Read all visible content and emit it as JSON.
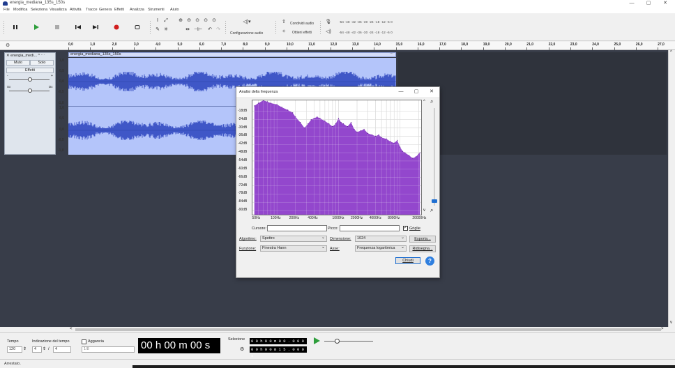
{
  "window": {
    "title": "energia_mediana_135s_150s",
    "minimize": "—",
    "maximize": "▢",
    "close": "✕"
  },
  "menu": [
    "File",
    "Modifica",
    "Seleziona",
    "Visualizza",
    "Attività",
    "Tracce",
    "Genera",
    "Effetti",
    "Analizza",
    "Strumenti",
    "Aiuto"
  ],
  "toolbar": {
    "audio_setup_label": "Configurazione audio",
    "share_audio_label": "Condividi audio",
    "get_effects_label": "Ottieni effetti",
    "meter_scale_record": "-54 -48 -42 -36 -30 -24 -18 -12 -6 0",
    "meter_scale_play": "-54 -48 -42 -36 -30 -24 -18 -12 -6 0"
  },
  "ruler": {
    "ticks": [
      "0,0",
      "1,0",
      "2,0",
      "3,0",
      "4,0",
      "5,0",
      "6,0",
      "7,0",
      "8,0",
      "9,0",
      "10,0",
      "11,0",
      "12,0",
      "13,0",
      "14,0",
      "15,0",
      "16,0",
      "17,0",
      "18,0",
      "19,0",
      "20,0",
      "21,0",
      "22,0",
      "23,0",
      "24,0",
      "25,0",
      "26,0",
      "27,0"
    ]
  },
  "track": {
    "name": "energia_medi...",
    "clip_name": "energia_mediana_135s_150s",
    "mute_label": "Muto",
    "solo_label": "Solo",
    "effects_label": "Effetti",
    "gain_left": "-",
    "gain_right": "+",
    "pan_left": "Sx",
    "pan_right": "Dx",
    "amplitude_top": [
      "1,0",
      "0,5",
      "0,0",
      "-0,5",
      "-1,0"
    ],
    "amplitude_bottom": [
      "1,0",
      "0,5",
      "0,0",
      "-0,5",
      "-1,0"
    ]
  },
  "bottom": {
    "tempo_label": "Tempo",
    "tempo_value": "120",
    "time_sig_label": "Indicazione del tempo",
    "time_sig_num": "4",
    "time_sig_den": "4",
    "snap_label": "Aggancia",
    "snap_value": "1/8",
    "clock": "00 h 00 m 00 s",
    "selection_label": "Selezione",
    "selection_start": "0 0 h 0 0 m 0 0 . 0 0 0 s",
    "selection_end": "0 0 h 0 0 m 1 5 . 0 0 0 s"
  },
  "status": {
    "text": "Arrestato."
  },
  "dialog": {
    "title": "Analisi della frequenza",
    "cursor_label": "Cursore:",
    "cursor_value": "",
    "peak_label": "Picco:",
    "peak_value": "",
    "grid_label": "Griglie",
    "algorithm_label": "Algoritmo:",
    "algorithm_value": "Spettro",
    "size_label": "Dimensione:",
    "size_value": "1024",
    "export_label": "Esporta...",
    "function_label": "Funzione:",
    "function_value": "Finestra Hann",
    "axis_label": "Asse:",
    "axis_value": "Frequenza logaritmica",
    "replot_label": "Ridisegna...",
    "close_label": "Chiudi",
    "help_label": "?"
  },
  "chart_data": {
    "type": "area",
    "title": "",
    "xlabel": "",
    "ylabel": "",
    "x_scale": "log",
    "xlim": [
      40,
      22000
    ],
    "ylim": [
      -93,
      -10
    ],
    "x_ticks": [
      "50Hz",
      "100Hz",
      "200Hz",
      "400Hz",
      "1000Hz",
      "2000Hz",
      "4000Hz",
      "8000Hz",
      "20000Hz"
    ],
    "y_ticks": [
      "-18dB",
      "-24dB",
      "-30dB",
      "-36dB",
      "-42dB",
      "-48dB",
      "-54dB",
      "-60dB",
      "-66dB",
      "-72dB",
      "-78dB",
      "-84dB",
      "-90dB"
    ],
    "grid": true,
    "fill_color": "#8a37c9",
    "x": [
      43,
      50,
      60,
      70,
      80,
      100,
      120,
      150,
      180,
      200,
      240,
      280,
      320,
      360,
      400,
      450,
      500,
      600,
      700,
      800,
      900,
      1000,
      1100,
      1200,
      1400,
      1600,
      1800,
      2000,
      2300,
      2600,
      3000,
      3500,
      4000,
      4500,
      5000,
      6000,
      7000,
      8000,
      9000,
      10000,
      11000,
      12000,
      14000,
      16000,
      18000,
      20000,
      21000
    ],
    "y": [
      -14,
      -12,
      -10,
      -11,
      -12,
      -13,
      -15,
      -17,
      -19,
      -22,
      -26,
      -30,
      -27,
      -24,
      -23,
      -22,
      -23,
      -25,
      -27,
      -29,
      -27,
      -23,
      -26,
      -27,
      -29,
      -26,
      -31,
      -33,
      -32,
      -31,
      -34,
      -35,
      -36,
      -35,
      -37,
      -38,
      -40,
      -41,
      -39,
      -44,
      -47,
      -48,
      -50,
      -52,
      -51,
      -49,
      -48
    ]
  }
}
